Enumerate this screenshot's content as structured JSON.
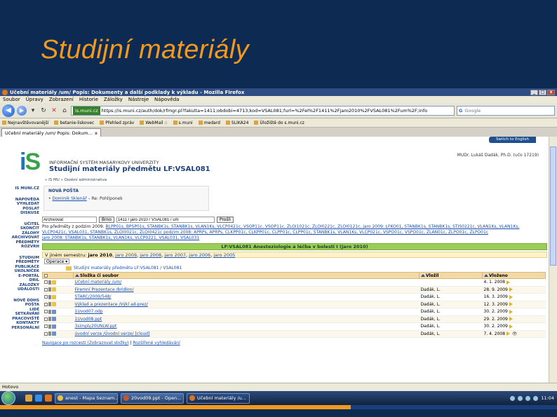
{
  "slide": {
    "title": "Studijní materiály"
  },
  "window": {
    "title": "Učební materiály /um/ Popis: Dokumenty a další podklady k výkladu - Mozilla Firefox",
    "buttons": {
      "min": "_",
      "max": "□",
      "close": "x"
    }
  },
  "menu": [
    "Soubor",
    "Úpravy",
    "Zobrazení",
    "Historie",
    "Záložky",
    "Nástroje",
    "Nápověda"
  ],
  "nav": {
    "url_badge": "is.muni.cz",
    "url": "https://is.muni.cz/auth/dok/rfmgr.pl?fakulta=1411;obdobi=4713;kod=VSAL081;furl=%2Fel%2F1411%2Fjaro2010%2FVSAL081%2Fum%2F;info",
    "search_engine": "G",
    "search_placeholder": "Google"
  },
  "bookmarks": [
    "Nejnavštěvovanější",
    "betanie-liskovec",
    "Přehled zpráv",
    "WebMail ::",
    "s.muni",
    "medard",
    "SLIKA24",
    "Úložiště do s.muni.cz"
  ],
  "tab": {
    "label": "Učební materiály /um/ Popis: Dokum...",
    "close": "x"
  },
  "page": {
    "lang_button": "Switch to English",
    "logo_main": "i",
    "logo_dot": "S",
    "university": "INFORMAČNÍ SYSTÉM MASARYKOVY UNIVERZITY",
    "heading": "Studijní materiály předmětu LF:VSAL081",
    "user": "MUDr. Lukáš Dadák, Ph.D. (učo 17219)",
    "crumbs": "» IS MU » Osobní administrativa"
  },
  "sidebar": [
    "IS MUNI.CZ",
    "NÁPOVĚDA",
    "VYHLEDAT",
    "POSLAT",
    "DISKUSE",
    "UČITEL",
    "SKONČIT",
    "ZÁLOHY",
    "ARCHIVOVAT",
    "PŘEDMĚTY",
    "ROZVRH",
    "STUDIUM",
    "PŘEDMĚTY",
    "PUBLIKACE",
    "ÚKOLNÍČEK",
    "E-PORTÁL",
    "DRIL",
    "ZÁLOŽKY",
    "UDÁLOSTI",
    "NOVÉ DDHS",
    "POŠTA",
    "LIDÉ",
    "SETKÁVÁNÍ",
    "PRACOVIŠTĚ",
    "KONTAKTY",
    "PERSONÁLNÍ"
  ],
  "news": {
    "title": "NOVÁ POŠTA",
    "sender": "Dominik Sklenář",
    "subject": "– Re: Pohlíponek"
  },
  "filter": {
    "field1_value": "Archivovat",
    "btn1": "Brno",
    "field2_value": "1411 / jaro 2010 / VSAL081 / um",
    "btn2": "Prošli"
  },
  "history": {
    "intro1": "Pro předměty z podzim 2009:",
    "line1": "BLPP01s, BPSP01s, STANBK1s, STANBK1s, VLAN1Ks, VLCP0421c, VSOP11c, VSOP11c, ZLOI1021c, ZLOI0221c, ZLOI0121c, jaro 2009: LFKO01, STANBK1s, STANBK1s, STIS0221c, VLAN1Ks, VLAN1Ks,",
    "line2": "VLCP0421c, VSAL031, STANBK1s, ZLOI0021c, ZLOI0421c podzim 2008: APRPs, APRPs, CLKPP01c, CLKPP01c, CLPP01c, CLPP01c, STANBK1s, VLAN1Ks, VLCP021c, VSPO01c, VSPO01c, ZLAN01c, ZLPO01c, ZLPO01c",
    "line3": "jaro 2008: STANBK1s, STANBK1s, VLAN1Ks, VLCP0221, VSAL031, VSAL031"
  },
  "course": {
    "bar": "LF:VSAL081 Anesteziologie a léčba v bolesti I (jaro 2010)"
  },
  "semesters": {
    "label": "V jiném semestru:",
    "items": [
      "jaro 2010",
      "jaro 2009",
      "jaro 2008",
      "jaro 2007",
      "jaro 2006",
      "jaro 2005"
    ]
  },
  "ops": {
    "label": "Operace",
    "select": "▾"
  },
  "folder": {
    "title": "Studijní materiály předmětu LF:VSAL081 / VSAL081"
  },
  "table": {
    "headers": [
      "Složka či soubor",
      "Vložil",
      "Vloženo"
    ],
    "rows": [
      {
        "name": "Učební materiály /um/",
        "author": "",
        "date": "4. 1. 2008",
        "type": "folder"
      },
      {
        "name": "Firemní Prezentace /bridlon/",
        "author": "Dadák, L.",
        "date": "28. 9. 2009",
        "type": "folder"
      },
      {
        "name": "STARC/2009/548/",
        "author": "Dadák, L.",
        "date": "16. 3. 2009",
        "type": "folder"
      },
      {
        "name": "Výklad a prezentace /Výkl ad-prez/",
        "author": "Dadák, L.",
        "date": "12. 3. 2009",
        "type": "folder"
      },
      {
        "name": "1Uvod07.odp",
        "author": "Dadák, L.",
        "date": "30. 2. 2009",
        "type": "file"
      },
      {
        "name": "1Uvod08.ppt",
        "author": "Dadák, L.",
        "date": "29. 2. 2009",
        "type": "file"
      },
      {
        "name": "3simply20UNLW.ppt",
        "author": "Dadák, L.",
        "date": "30. 2. 2009",
        "type": "file"
      },
      {
        "name": "úvodní verze /Úvodní verze/ [cloud]",
        "author": "Dadák, L.",
        "date": "7. 4. 2008",
        "type": "file"
      }
    ]
  },
  "bottom_links": {
    "link1": "Navigace po rozcestí (Zobrazovat složky)",
    "link2": "Rozšířené vyhledávání"
  },
  "status": "Hotovo",
  "taskbar": {
    "tasks": [
      "anest - Mapa Seznam...",
      "20vod09.ppt - Open...",
      "Učební materiály /u..."
    ],
    "clock": "11:04"
  }
}
